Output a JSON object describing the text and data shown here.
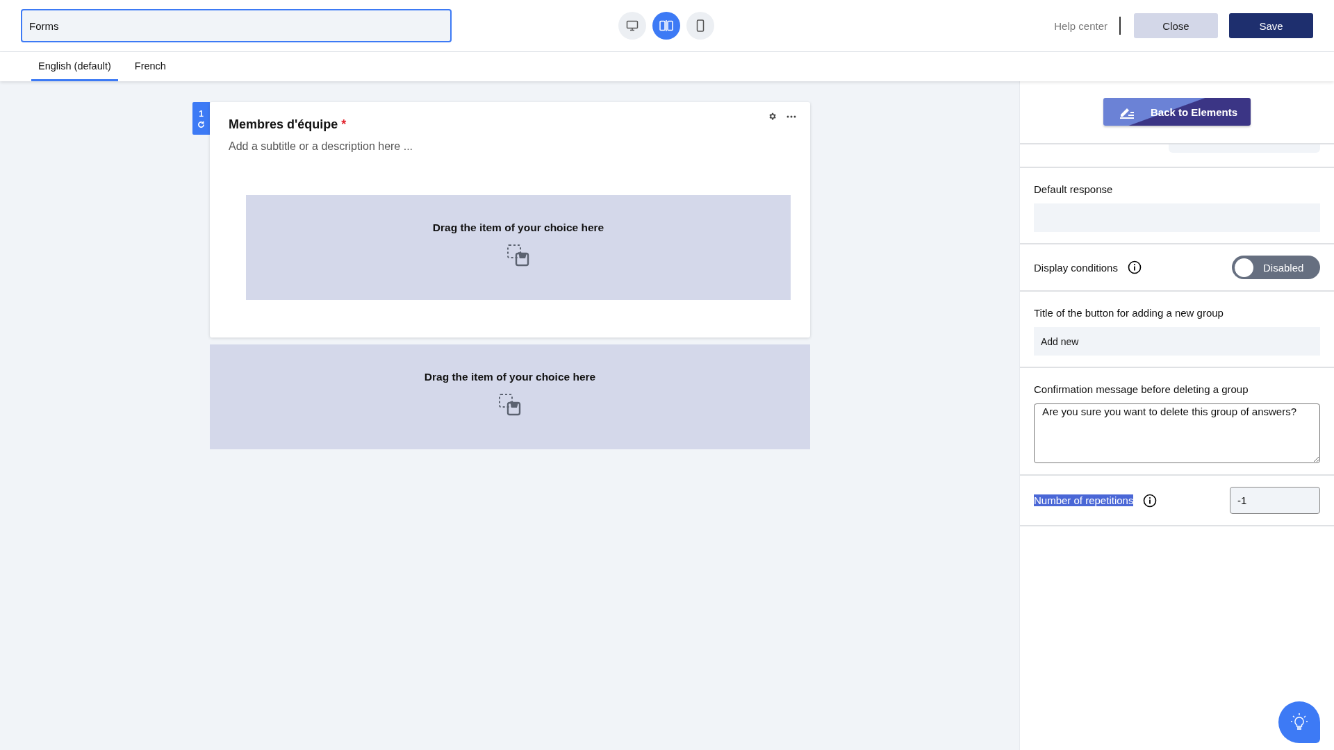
{
  "header": {
    "title_field": {
      "value": "Forms"
    },
    "view_modes": [
      {
        "kind": "desktop",
        "selected": false
      },
      {
        "kind": "split",
        "selected": true
      },
      {
        "kind": "mobile",
        "selected": false
      }
    ],
    "help_center": "Help center",
    "close_button": "Close",
    "save_button": "Save"
  },
  "language_tabs": [
    {
      "label": "English (default)",
      "selected": true
    },
    {
      "label": "French",
      "selected": false
    }
  ],
  "question": {
    "number": "1",
    "title": "Membres d'équipe",
    "required_mark": "*",
    "subtitle_placeholder": "Add a subtitle or a description here ...",
    "inner_drop_zone": "Drag the item of your choice here"
  },
  "outer_drop_zone": "Drag the item of your choice here",
  "panel": {
    "back_button": "Back to Elements",
    "default_response": {
      "label": "Default response"
    },
    "display_conditions": {
      "label": "Display conditions",
      "on": false,
      "toggle_label": "Disabled"
    },
    "add_button_title": {
      "label": "Title of the button for adding a new group",
      "value": "Add new"
    },
    "confirmation": {
      "label": "Confirmation message before deleting a group",
      "value": "Are you sure you want to delete this group of answers?"
    },
    "repetitions": {
      "label": "Number of repetitions",
      "highlighted": true,
      "value": "-1"
    }
  }
}
